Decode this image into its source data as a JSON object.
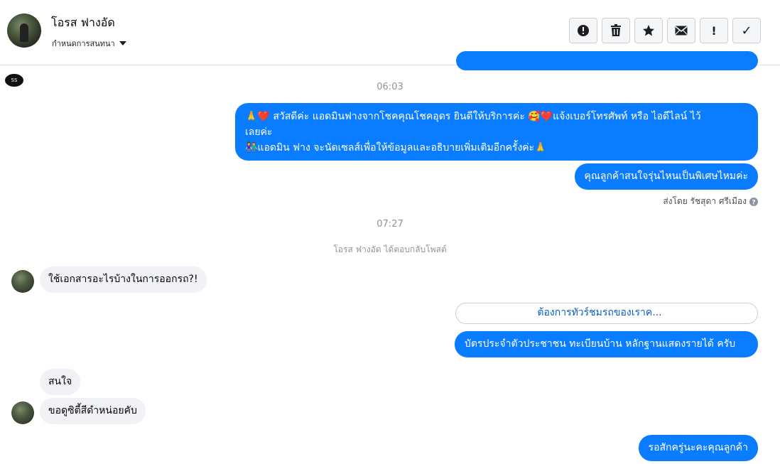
{
  "header": {
    "contact_name": "โอรส ฟางอัด",
    "conversation_settings": "กำหนดการสนทนา",
    "toolbar": {
      "icons": [
        "alert-circle-icon",
        "trash-icon",
        "star-icon",
        "envelope-icon",
        "exclamation-icon",
        "check-icon"
      ],
      "exclamation_glyph": "!",
      "check_glyph": "✓"
    }
  },
  "thread": {
    "page_logo_text": "SS",
    "time1": "06:03",
    "msg_out_1": {
      "line1": "🙏❤️ สวัสดีค่ะ แอดมินฟางจากโชคคุณโชคอุดร ยินดีให้บริการค่ะ 🥰❤️แจ้งเบอร์โทรศัพท์ หรือ ไอดีไลน์ ไว้",
      "line2": "เลยค่ะ",
      "line3": "👫แอดมิน ฟาง จะนัดเซลส์เพื่อให้ข้อมูลและอธิบายเพิ่มเติมอีกครั้งค่ะ🙏"
    },
    "msg_out_2": "คุณลูกค้าสนใจรุ่นไหนเป็นพิเศษไหมค่ะ",
    "sent_by": "ส่งโดย รัชสุดา ศรีเมือง",
    "time2": "07:27",
    "replied_to_post": "โอรส ฟางอัด ได้ตอบกลับโพสต์",
    "msg_in_1": "ใช้เอกสารอะไรบ้างในการออกรถ?!",
    "quick_reply": "ต้องการทัวร์ชมรถของเราค...",
    "msg_out_3": "บัตรประจำตัวประชาชน ทะเบียนบ้าน หลักฐานแสดงรายได้ ครับ",
    "msg_in_2": "สนใจ",
    "msg_in_3": "ขอดูซิตี้สีดำหน่อยคับ",
    "msg_out_4": "รอสักครู่นะคะคุณลูกค้า"
  },
  "colors": {
    "accent_blue": "#0a7cff",
    "incoming_bubble": "#f0f2f5",
    "meta_text": "#90949c"
  }
}
